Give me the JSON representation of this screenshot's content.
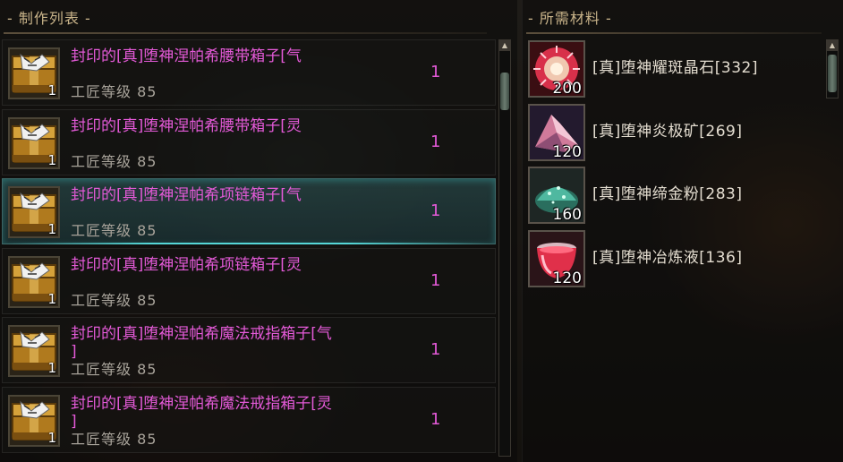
{
  "left_panel": {
    "title": "- 制作列表 -",
    "recipes": [
      {
        "name": "封印的[真]堕神涅帕希腰带箱子[气",
        "level": "工匠等级 85",
        "qty": "1",
        "icon_count": "1"
      },
      {
        "name": "封印的[真]堕神涅帕希腰带箱子[灵",
        "level": "工匠等级 85",
        "qty": "1",
        "icon_count": "1"
      },
      {
        "name": "封印的[真]堕神涅帕希项链箱子[气",
        "level": "工匠等级 85",
        "qty": "1",
        "icon_count": "1"
      },
      {
        "name": "封印的[真]堕神涅帕希项链箱子[灵",
        "level": "工匠等级 85",
        "qty": "1",
        "icon_count": "1"
      },
      {
        "name": "封印的[真]堕神涅帕希魔法戒指箱子[气\n]",
        "level": "工匠等级 85",
        "qty": "1",
        "icon_count": "1"
      },
      {
        "name": "封印的[真]堕神涅帕希魔法戒指箱子[灵\n]",
        "level": "工匠等级 85",
        "qty": "1",
        "icon_count": "1"
      }
    ],
    "selected_index": 2
  },
  "right_panel": {
    "title": "- 所需材料 -",
    "materials": [
      {
        "name": "[真]堕神耀斑晶石[332]",
        "count": "200",
        "icon": "red-crystal-icon",
        "color": "#d8304a"
      },
      {
        "name": "[真]堕神炎极矿[269]",
        "count": "120",
        "icon": "pink-ore-icon",
        "color": "#d07a9a"
      },
      {
        "name": "[真]堕神缔金粉[283]",
        "count": "160",
        "icon": "teal-powder-icon",
        "color": "#4fb8a0"
      },
      {
        "name": "[真]堕神冶炼液[136]",
        "count": "120",
        "icon": "red-liquid-icon",
        "color": "#e0304a"
      }
    ]
  },
  "colors": {
    "recipe_text": "#e45ad8",
    "title_text": "#c9b48a",
    "level_text": "#a8a39a"
  }
}
